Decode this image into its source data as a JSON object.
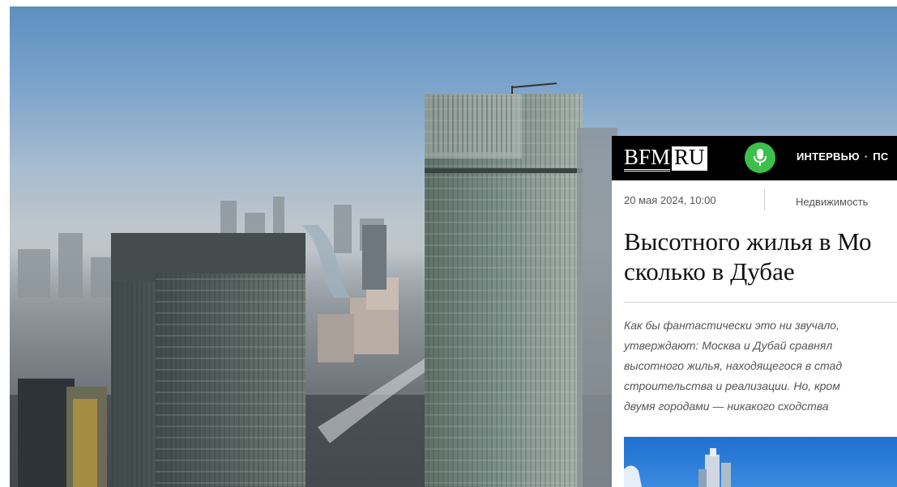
{
  "article": {
    "logo_bfm": "BFM",
    "logo_ru": "RU",
    "nav_item_1": "ИНТЕРВЬЮ",
    "nav_separator": "·",
    "nav_item_2": "ПС",
    "date": "20 мая 2024, 10:00",
    "category": "Недвижимость",
    "headline_lines": [
      "Высотного жилья в Мо",
      "сколько в Дубае"
    ],
    "lead_lines": [
      "Как бы фантастически это ни звучало,",
      "утверждают: Москва и Дубай сравнял",
      "высотного жилья, находящегося в стад",
      "строительства и реализации. Но, кром",
      "двумя городами — никакого сходства"
    ]
  },
  "icons": {
    "microphone": "microphone-icon"
  },
  "colors": {
    "topbar": "#000000",
    "mic_button": "#3cc04a",
    "sky": "#6f9bc8"
  }
}
